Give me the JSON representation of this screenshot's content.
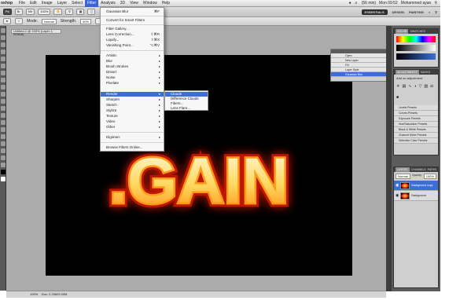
{
  "menubar": {
    "app_name": "oshop",
    "items": [
      "File",
      "Edit",
      "Image",
      "Layer",
      "Select",
      "Filter",
      "Analysis",
      "3D",
      "View",
      "Window",
      "Help"
    ],
    "active_index": 5,
    "clock": "Mon 09:52",
    "user": "Mohammed ayan",
    "battery": "(56 min)"
  },
  "appbar": {
    "zoom": "100%",
    "workspaces": [
      "ESSENTIALS",
      "DESIGN",
      "PAINTING"
    ],
    "more": "»"
  },
  "optbar": {
    "mode_label": "Mode:",
    "mode_value": "Normal",
    "strength_label": "Strength:",
    "strength_value": "50%"
  },
  "document": {
    "tab_title": "Untitled-1 @ 100% (Layer 1, RGB/8)",
    "status_zoom": "100%",
    "status_doc": "Doc: 2.25M/3.00M"
  },
  "canvas_text": ".GAIN",
  "filter_menu": {
    "items": [
      {
        "label": "Gaussian Blur",
        "shortcut": "⌘F"
      },
      {
        "label": "Convert for Smart Filters"
      },
      {
        "label": "Filter Gallery..."
      },
      {
        "label": "Lens Correction...",
        "shortcut": "⇧⌘R"
      },
      {
        "label": "Liquify...",
        "shortcut": "⇧⌘X"
      },
      {
        "label": "Vanishing Point...",
        "shortcut": "⌥⌘V"
      },
      {
        "label": "Artistic"
      },
      {
        "label": "Blur"
      },
      {
        "label": "Brush Strokes"
      },
      {
        "label": "Distort"
      },
      {
        "label": "Noise"
      },
      {
        "label": "Pixelate"
      },
      {
        "label": "Render"
      },
      {
        "label": "Sharpen"
      },
      {
        "label": "Sketch"
      },
      {
        "label": "Stylize"
      },
      {
        "label": "Texture"
      },
      {
        "label": "Video"
      },
      {
        "label": "Other"
      },
      {
        "label": "Digimarc"
      },
      {
        "label": "Browse Filters Online..."
      }
    ]
  },
  "render_submenu": {
    "items": [
      "Clouds",
      "Difference Clouds",
      "Fibers...",
      "Lens Flare..."
    ],
    "highlighted_index": 0
  },
  "history_panel": {
    "rows": [
      "Open",
      "New Layer",
      "Fill",
      "Layer Style",
      "Gaussian Blur"
    ]
  },
  "adjustments_panel": {
    "tabs": [
      "ADJUSTMENTS",
      "MASKS"
    ],
    "title": "Add an adjustment",
    "presets": [
      "Levels Presets",
      "Curves Presets",
      "Exposure Presets",
      "Hue/Saturation Presets",
      "Black & White Presets",
      "Channel Mixer Presets",
      "Selective Color Presets"
    ]
  },
  "layers_panel": {
    "tabs": [
      "LAYERS",
      "CHANNELS",
      "PATHS"
    ],
    "blend_mode": "Normal",
    "opacity_label": "Opacity:",
    "opacity_value": "100%",
    "layers": [
      {
        "name": "Background copy"
      },
      {
        "name": "Background"
      }
    ]
  },
  "colors": {
    "highlight": "#3c6fd6",
    "fire_core": "#fff6c8",
    "fire_mid": "#ffb21c",
    "fire_edge": "#e01a00"
  }
}
